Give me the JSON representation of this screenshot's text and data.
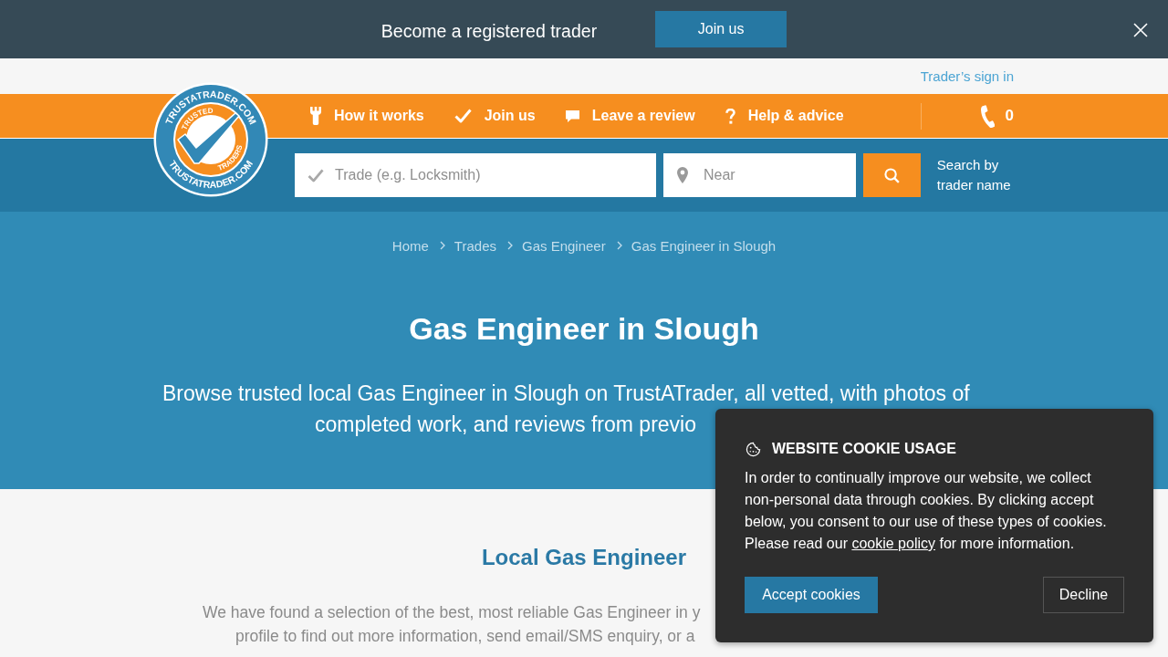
{
  "promo_banner": {
    "text": "Become a registered trader",
    "button": "Join us"
  },
  "top_links": {
    "sign_in": "Trader’s sign in"
  },
  "logo": {
    "ring_top": "TRUSTATRADER.COM",
    "ring_bottom": "TRUSTATRADER.COM",
    "inner_top": "TRUSTED",
    "inner_bottom": "TRADERS"
  },
  "nav": {
    "items": [
      {
        "label": "How it works"
      },
      {
        "label": "Join us"
      },
      {
        "label": "Leave a review"
      },
      {
        "label": "Help & advice"
      }
    ],
    "phone_count": "0"
  },
  "search": {
    "trade_placeholder": "Trade (e.g. Locksmith)",
    "near_placeholder": "Near",
    "trader_name_link": "Search by trader name"
  },
  "breadcrumb": [
    {
      "label": "Home"
    },
    {
      "label": "Trades"
    },
    {
      "label": "Gas Engineer"
    },
    {
      "label": "Gas Engineer in Slough"
    }
  ],
  "hero": {
    "title": "Gas Engineer in Slough",
    "description": "Browse trusted local Gas Engineer in Slough on TrustATrader, all vetted, with photos of completed work, and reviews from previo"
  },
  "section": {
    "heading": "Local Gas Engineer",
    "intro": "We have found a selection of the best, most reliable Gas Engineer in y profile to find out more information, send email/SMS enquiry, or a"
  },
  "cookie_notice": {
    "title": "WEBSITE COOKIE USAGE",
    "text_before": "In order to continually improve our website, we collect non-personal data through cookies. By clicking accept below, you consent to our use of these types of cookies. Please read our ",
    "link": "cookie policy",
    "text_after": " for more information.",
    "accept_button": "Accept cookies",
    "decline_button": "Decline"
  }
}
